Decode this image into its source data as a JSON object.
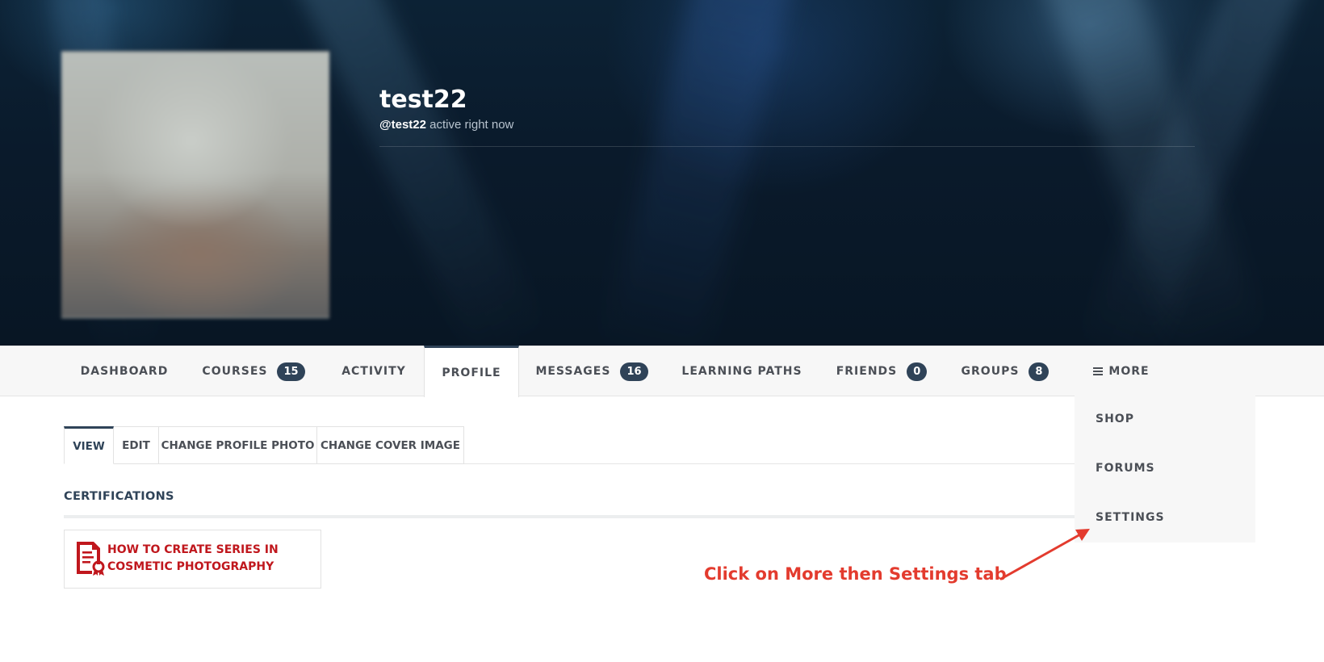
{
  "profile": {
    "display_name": "test22",
    "handle": "@test22",
    "status": " active right now"
  },
  "nav": {
    "items": [
      {
        "label": "DASHBOARD"
      },
      {
        "label": "COURSES",
        "badge": "15"
      },
      {
        "label": "ACTIVITY"
      },
      {
        "label": "PROFILE",
        "active": true
      },
      {
        "label": "MESSAGES",
        "badge": "16"
      },
      {
        "label": "LEARNING PATHS"
      },
      {
        "label": "FRIENDS",
        "badge": "0"
      },
      {
        "label": "GROUPS",
        "badge": "8"
      },
      {
        "label": "MORE",
        "icon": "hamburger-icon"
      }
    ]
  },
  "more_menu": {
    "items": [
      {
        "label": "SHOP"
      },
      {
        "label": "FORUMS"
      },
      {
        "label": "SETTINGS"
      }
    ]
  },
  "subtabs": [
    {
      "label": "VIEW",
      "active": true
    },
    {
      "label": "EDIT"
    },
    {
      "label": "CHANGE PROFILE PHOTO"
    },
    {
      "label": "CHANGE COVER IMAGE"
    }
  ],
  "certifications": {
    "title": "CERTIFICATIONS",
    "items": [
      {
        "title": "HOW TO CREATE SERIES IN COSMETIC PHOTOGRAPHY",
        "icon": "certificate-icon"
      }
    ]
  },
  "annotation": {
    "text": "Click on More then Settings tab",
    "color": "#e33b2e"
  },
  "colors": {
    "accent": "#2f4358",
    "cert_red": "#c0171d"
  }
}
